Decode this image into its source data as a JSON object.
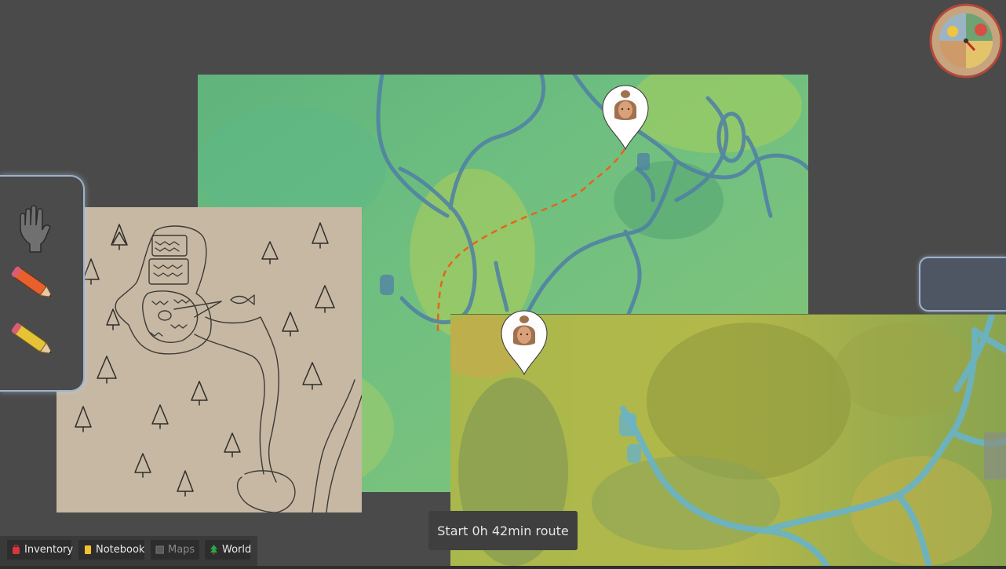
{
  "route": {
    "label": "Start 0h 42min route"
  },
  "tabs": [
    {
      "label": "Inventory",
      "icon": "backpack-icon",
      "color": "#d9363e",
      "enabled": true
    },
    {
      "label": "Notebook",
      "icon": "notebook-icon",
      "color": "#f2c230",
      "enabled": true
    },
    {
      "label": "Maps",
      "icon": "map-icon",
      "color": "#777777",
      "enabled": false
    },
    {
      "label": "World",
      "icon": "tree-icon",
      "color": "#2aa84a",
      "enabled": true
    }
  ],
  "tools": [
    {
      "icon": "hand-icon",
      "selected": true
    },
    {
      "icon": "red-pencil-icon",
      "selected": false
    },
    {
      "icon": "yellow-pencil-icon",
      "selected": false
    }
  ],
  "colors": {
    "background": "#4a4a4a",
    "panel_border": "#9db2cc",
    "route_line": "#e8621c"
  }
}
